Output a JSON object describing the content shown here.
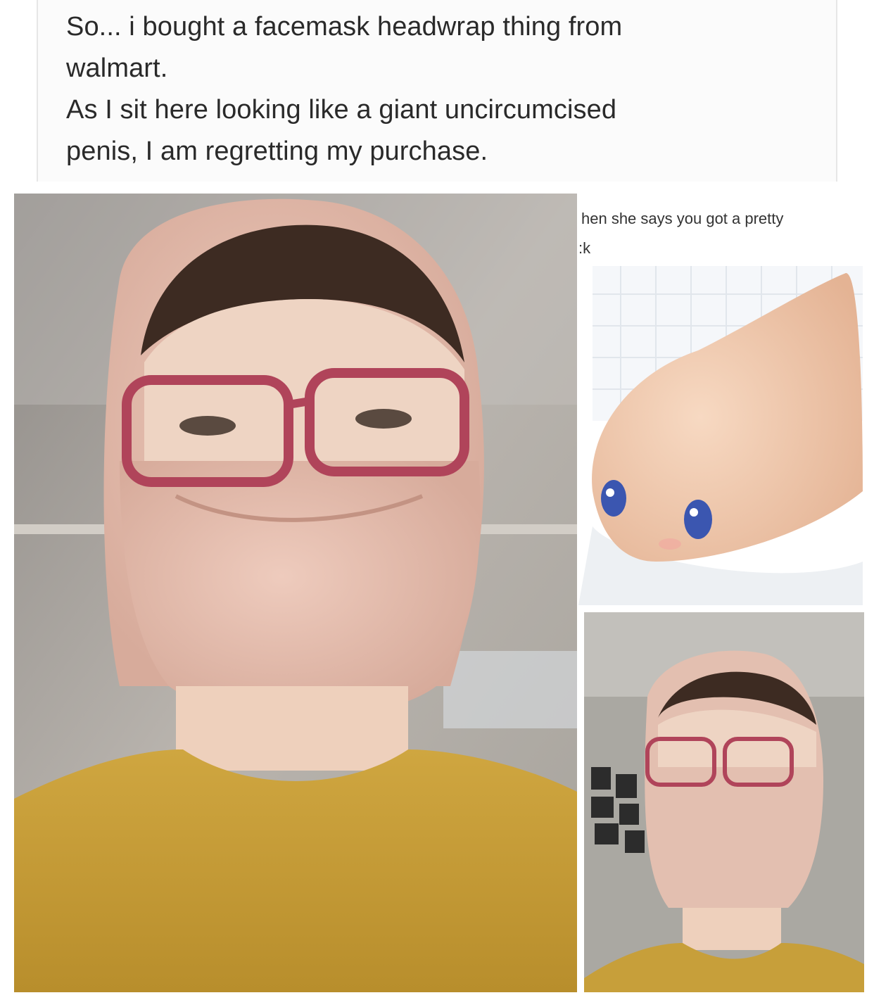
{
  "post": {
    "lines": [
      "So... i bought a facemask headwrap thing from",
      "walmart.",
      "As I sit here looking like a giant uncircumcised",
      "penis, I am regretting my purchase."
    ]
  },
  "meme_caption": {
    "lines": [
      "hen she says you got a pretty",
      ":k"
    ]
  },
  "colors": {
    "mask": "#e8c3b5",
    "sweater": "#c9a13a",
    "glasses": "#b0445a",
    "skin": "#f2cdb0"
  }
}
